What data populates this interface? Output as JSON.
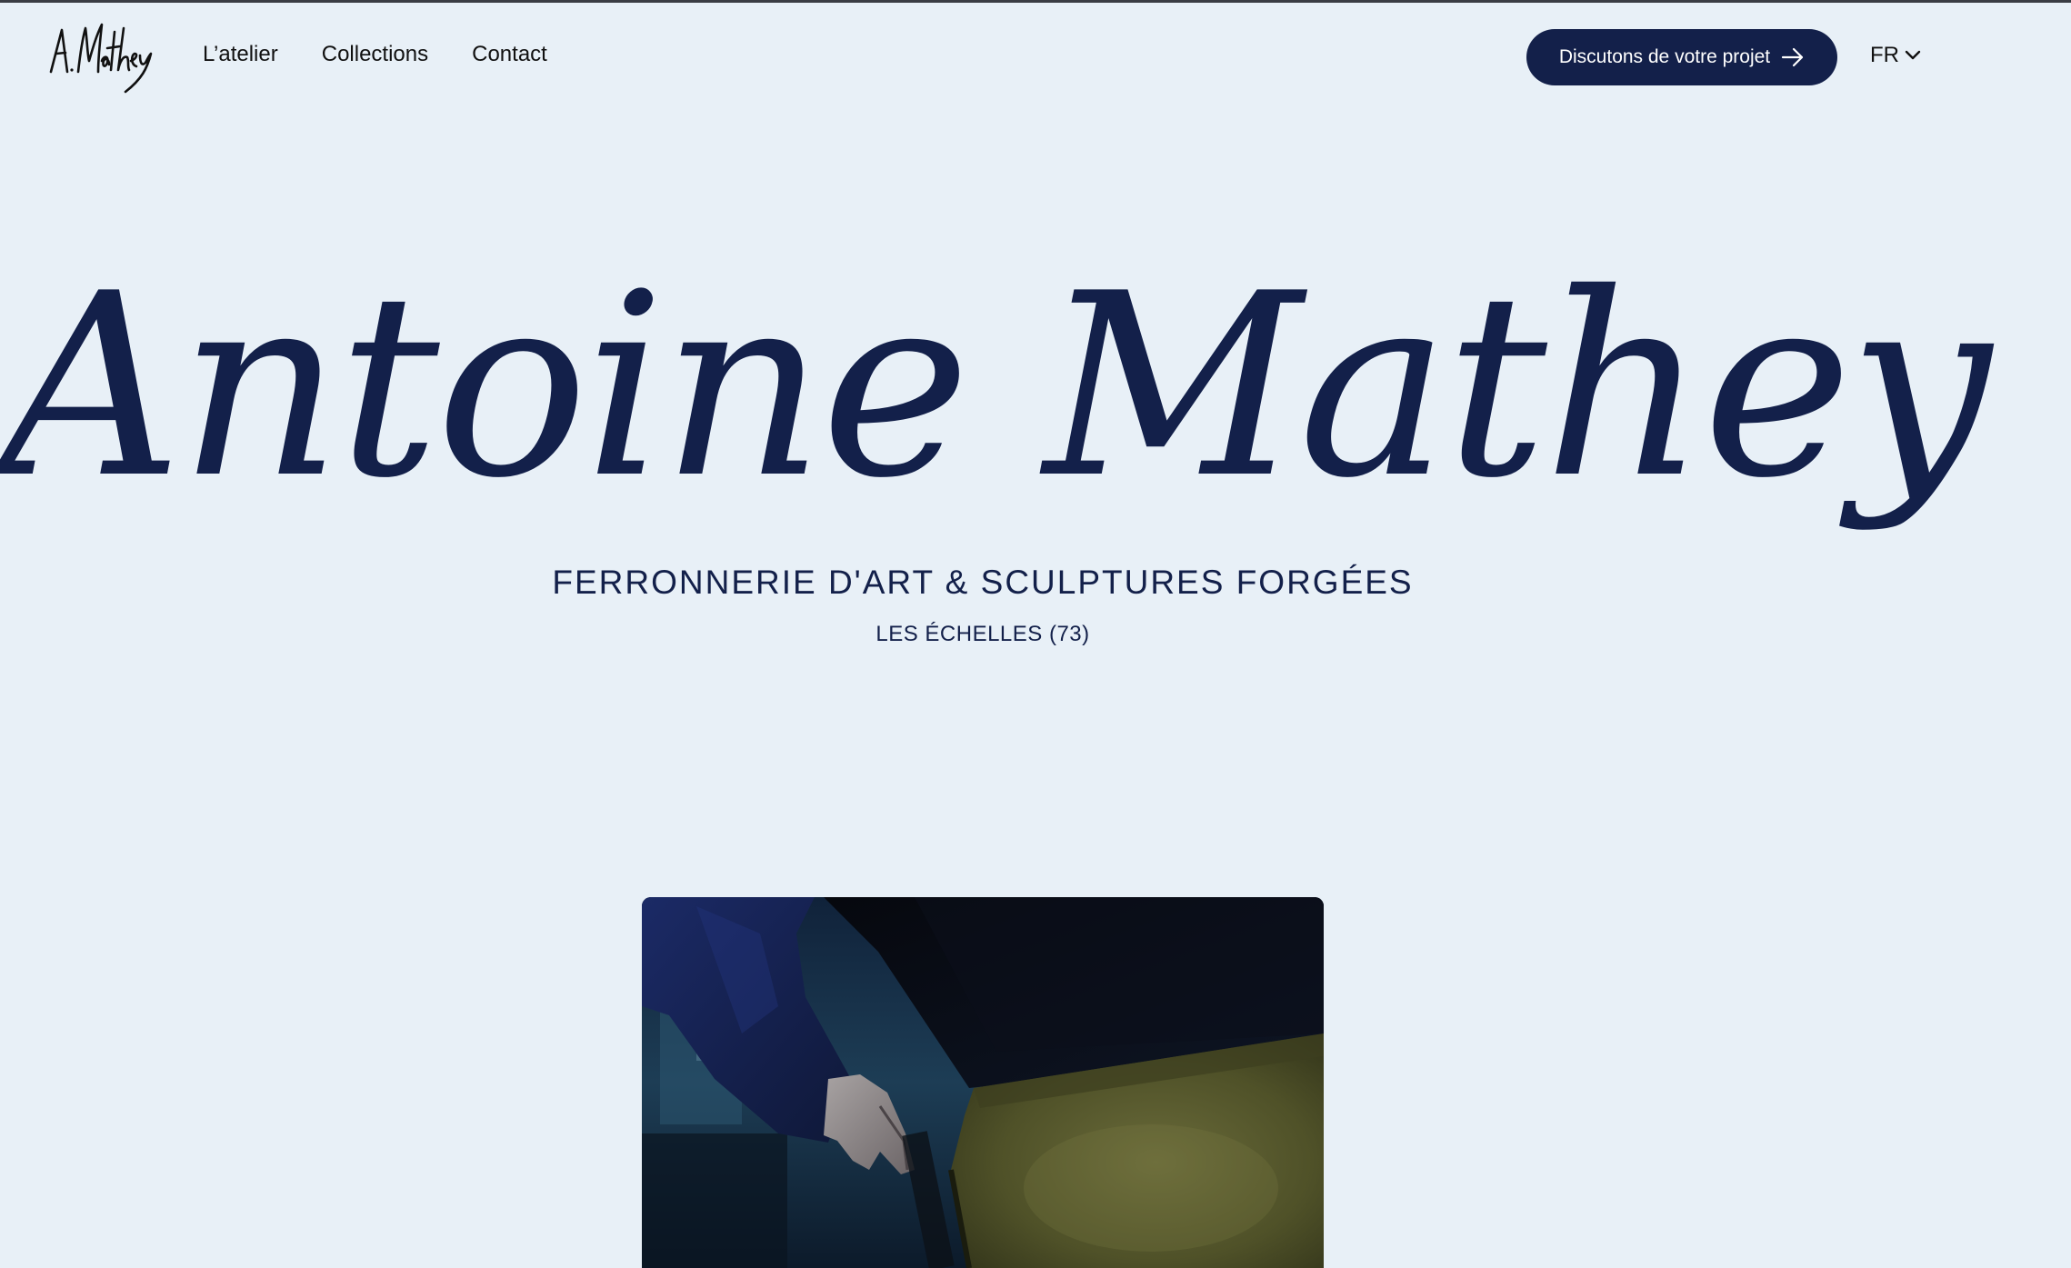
{
  "brand": {
    "logo_text": "A. Mathey"
  },
  "nav": {
    "items": [
      {
        "label": "L’atelier"
      },
      {
        "label": "Collections"
      },
      {
        "label": "Contact"
      }
    ]
  },
  "cta": {
    "label": "Discutons de votre projet",
    "icon": "arrow-right-icon"
  },
  "language": {
    "selected": "FR",
    "icon": "chevron-down-icon"
  },
  "hero": {
    "title": "Antoine Mathey",
    "subtitle": "FERRONNERIE D'ART & SCULPTURES FORGÉES",
    "location": "LES ÉCHELLES (73)"
  },
  "photo": {
    "subject": "hand-in-work-apron-photo"
  },
  "colors": {
    "background": "#e8f0f7",
    "navy": "#13204a",
    "nav_text": "#111111",
    "button_text": "#ffffff"
  }
}
